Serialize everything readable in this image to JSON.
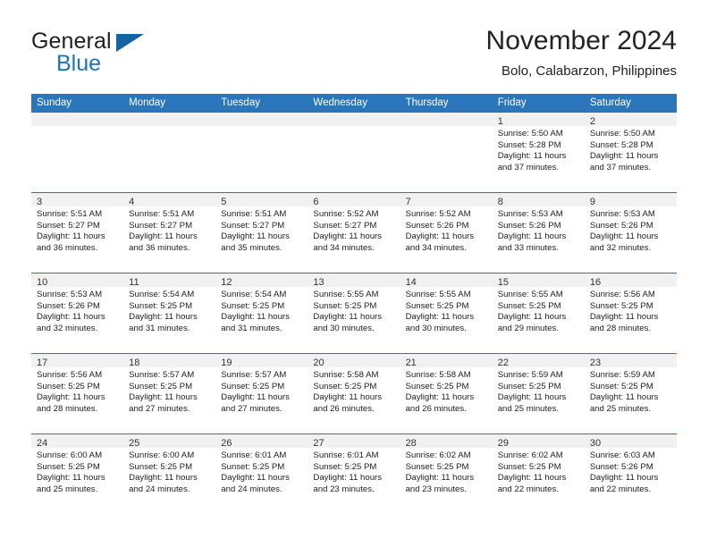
{
  "brand": {
    "word_one": "General",
    "word_two": "Blue",
    "triangle_color": "#1464a5",
    "blue_text_color": "#1b75bb"
  },
  "header": {
    "title": "November 2024",
    "location": "Bolo, Calabarzon, Philippines"
  },
  "theme": {
    "header_bar_color": "#2b76bb",
    "day_band_color": "#f1f1f1",
    "cell_border_color": "#2b76bb"
  },
  "weekdays": [
    "Sunday",
    "Monday",
    "Tuesday",
    "Wednesday",
    "Thursday",
    "Friday",
    "Saturday"
  ],
  "weeks": [
    [
      {
        "day": "",
        "lines": []
      },
      {
        "day": "",
        "lines": []
      },
      {
        "day": "",
        "lines": []
      },
      {
        "day": "",
        "lines": []
      },
      {
        "day": "",
        "lines": []
      },
      {
        "day": "1",
        "lines": [
          "Sunrise: 5:50 AM",
          "Sunset: 5:28 PM",
          "Daylight: 11 hours",
          "and 37 minutes."
        ]
      },
      {
        "day": "2",
        "lines": [
          "Sunrise: 5:50 AM",
          "Sunset: 5:28 PM",
          "Daylight: 11 hours",
          "and 37 minutes."
        ]
      }
    ],
    [
      {
        "day": "3",
        "lines": [
          "Sunrise: 5:51 AM",
          "Sunset: 5:27 PM",
          "Daylight: 11 hours",
          "and 36 minutes."
        ]
      },
      {
        "day": "4",
        "lines": [
          "Sunrise: 5:51 AM",
          "Sunset: 5:27 PM",
          "Daylight: 11 hours",
          "and 36 minutes."
        ]
      },
      {
        "day": "5",
        "lines": [
          "Sunrise: 5:51 AM",
          "Sunset: 5:27 PM",
          "Daylight: 11 hours",
          "and 35 minutes."
        ]
      },
      {
        "day": "6",
        "lines": [
          "Sunrise: 5:52 AM",
          "Sunset: 5:27 PM",
          "Daylight: 11 hours",
          "and 34 minutes."
        ]
      },
      {
        "day": "7",
        "lines": [
          "Sunrise: 5:52 AM",
          "Sunset: 5:26 PM",
          "Daylight: 11 hours",
          "and 34 minutes."
        ]
      },
      {
        "day": "8",
        "lines": [
          "Sunrise: 5:53 AM",
          "Sunset: 5:26 PM",
          "Daylight: 11 hours",
          "and 33 minutes."
        ]
      },
      {
        "day": "9",
        "lines": [
          "Sunrise: 5:53 AM",
          "Sunset: 5:26 PM",
          "Daylight: 11 hours",
          "and 32 minutes."
        ]
      }
    ],
    [
      {
        "day": "10",
        "lines": [
          "Sunrise: 5:53 AM",
          "Sunset: 5:26 PM",
          "Daylight: 11 hours",
          "and 32 minutes."
        ]
      },
      {
        "day": "11",
        "lines": [
          "Sunrise: 5:54 AM",
          "Sunset: 5:25 PM",
          "Daylight: 11 hours",
          "and 31 minutes."
        ]
      },
      {
        "day": "12",
        "lines": [
          "Sunrise: 5:54 AM",
          "Sunset: 5:25 PM",
          "Daylight: 11 hours",
          "and 31 minutes."
        ]
      },
      {
        "day": "13",
        "lines": [
          "Sunrise: 5:55 AM",
          "Sunset: 5:25 PM",
          "Daylight: 11 hours",
          "and 30 minutes."
        ]
      },
      {
        "day": "14",
        "lines": [
          "Sunrise: 5:55 AM",
          "Sunset: 5:25 PM",
          "Daylight: 11 hours",
          "and 30 minutes."
        ]
      },
      {
        "day": "15",
        "lines": [
          "Sunrise: 5:55 AM",
          "Sunset: 5:25 PM",
          "Daylight: 11 hours",
          "and 29 minutes."
        ]
      },
      {
        "day": "16",
        "lines": [
          "Sunrise: 5:56 AM",
          "Sunset: 5:25 PM",
          "Daylight: 11 hours",
          "and 28 minutes."
        ]
      }
    ],
    [
      {
        "day": "17",
        "lines": [
          "Sunrise: 5:56 AM",
          "Sunset: 5:25 PM",
          "Daylight: 11 hours",
          "and 28 minutes."
        ]
      },
      {
        "day": "18",
        "lines": [
          "Sunrise: 5:57 AM",
          "Sunset: 5:25 PM",
          "Daylight: 11 hours",
          "and 27 minutes."
        ]
      },
      {
        "day": "19",
        "lines": [
          "Sunrise: 5:57 AM",
          "Sunset: 5:25 PM",
          "Daylight: 11 hours",
          "and 27 minutes."
        ]
      },
      {
        "day": "20",
        "lines": [
          "Sunrise: 5:58 AM",
          "Sunset: 5:25 PM",
          "Daylight: 11 hours",
          "and 26 minutes."
        ]
      },
      {
        "day": "21",
        "lines": [
          "Sunrise: 5:58 AM",
          "Sunset: 5:25 PM",
          "Daylight: 11 hours",
          "and 26 minutes."
        ]
      },
      {
        "day": "22",
        "lines": [
          "Sunrise: 5:59 AM",
          "Sunset: 5:25 PM",
          "Daylight: 11 hours",
          "and 25 minutes."
        ]
      },
      {
        "day": "23",
        "lines": [
          "Sunrise: 5:59 AM",
          "Sunset: 5:25 PM",
          "Daylight: 11 hours",
          "and 25 minutes."
        ]
      }
    ],
    [
      {
        "day": "24",
        "lines": [
          "Sunrise: 6:00 AM",
          "Sunset: 5:25 PM",
          "Daylight: 11 hours",
          "and 25 minutes."
        ]
      },
      {
        "day": "25",
        "lines": [
          "Sunrise: 6:00 AM",
          "Sunset: 5:25 PM",
          "Daylight: 11 hours",
          "and 24 minutes."
        ]
      },
      {
        "day": "26",
        "lines": [
          "Sunrise: 6:01 AM",
          "Sunset: 5:25 PM",
          "Daylight: 11 hours",
          "and 24 minutes."
        ]
      },
      {
        "day": "27",
        "lines": [
          "Sunrise: 6:01 AM",
          "Sunset: 5:25 PM",
          "Daylight: 11 hours",
          "and 23 minutes."
        ]
      },
      {
        "day": "28",
        "lines": [
          "Sunrise: 6:02 AM",
          "Sunset: 5:25 PM",
          "Daylight: 11 hours",
          "and 23 minutes."
        ]
      },
      {
        "day": "29",
        "lines": [
          "Sunrise: 6:02 AM",
          "Sunset: 5:25 PM",
          "Daylight: 11 hours",
          "and 22 minutes."
        ]
      },
      {
        "day": "30",
        "lines": [
          "Sunrise: 6:03 AM",
          "Sunset: 5:26 PM",
          "Daylight: 11 hours",
          "and 22 minutes."
        ]
      }
    ]
  ]
}
